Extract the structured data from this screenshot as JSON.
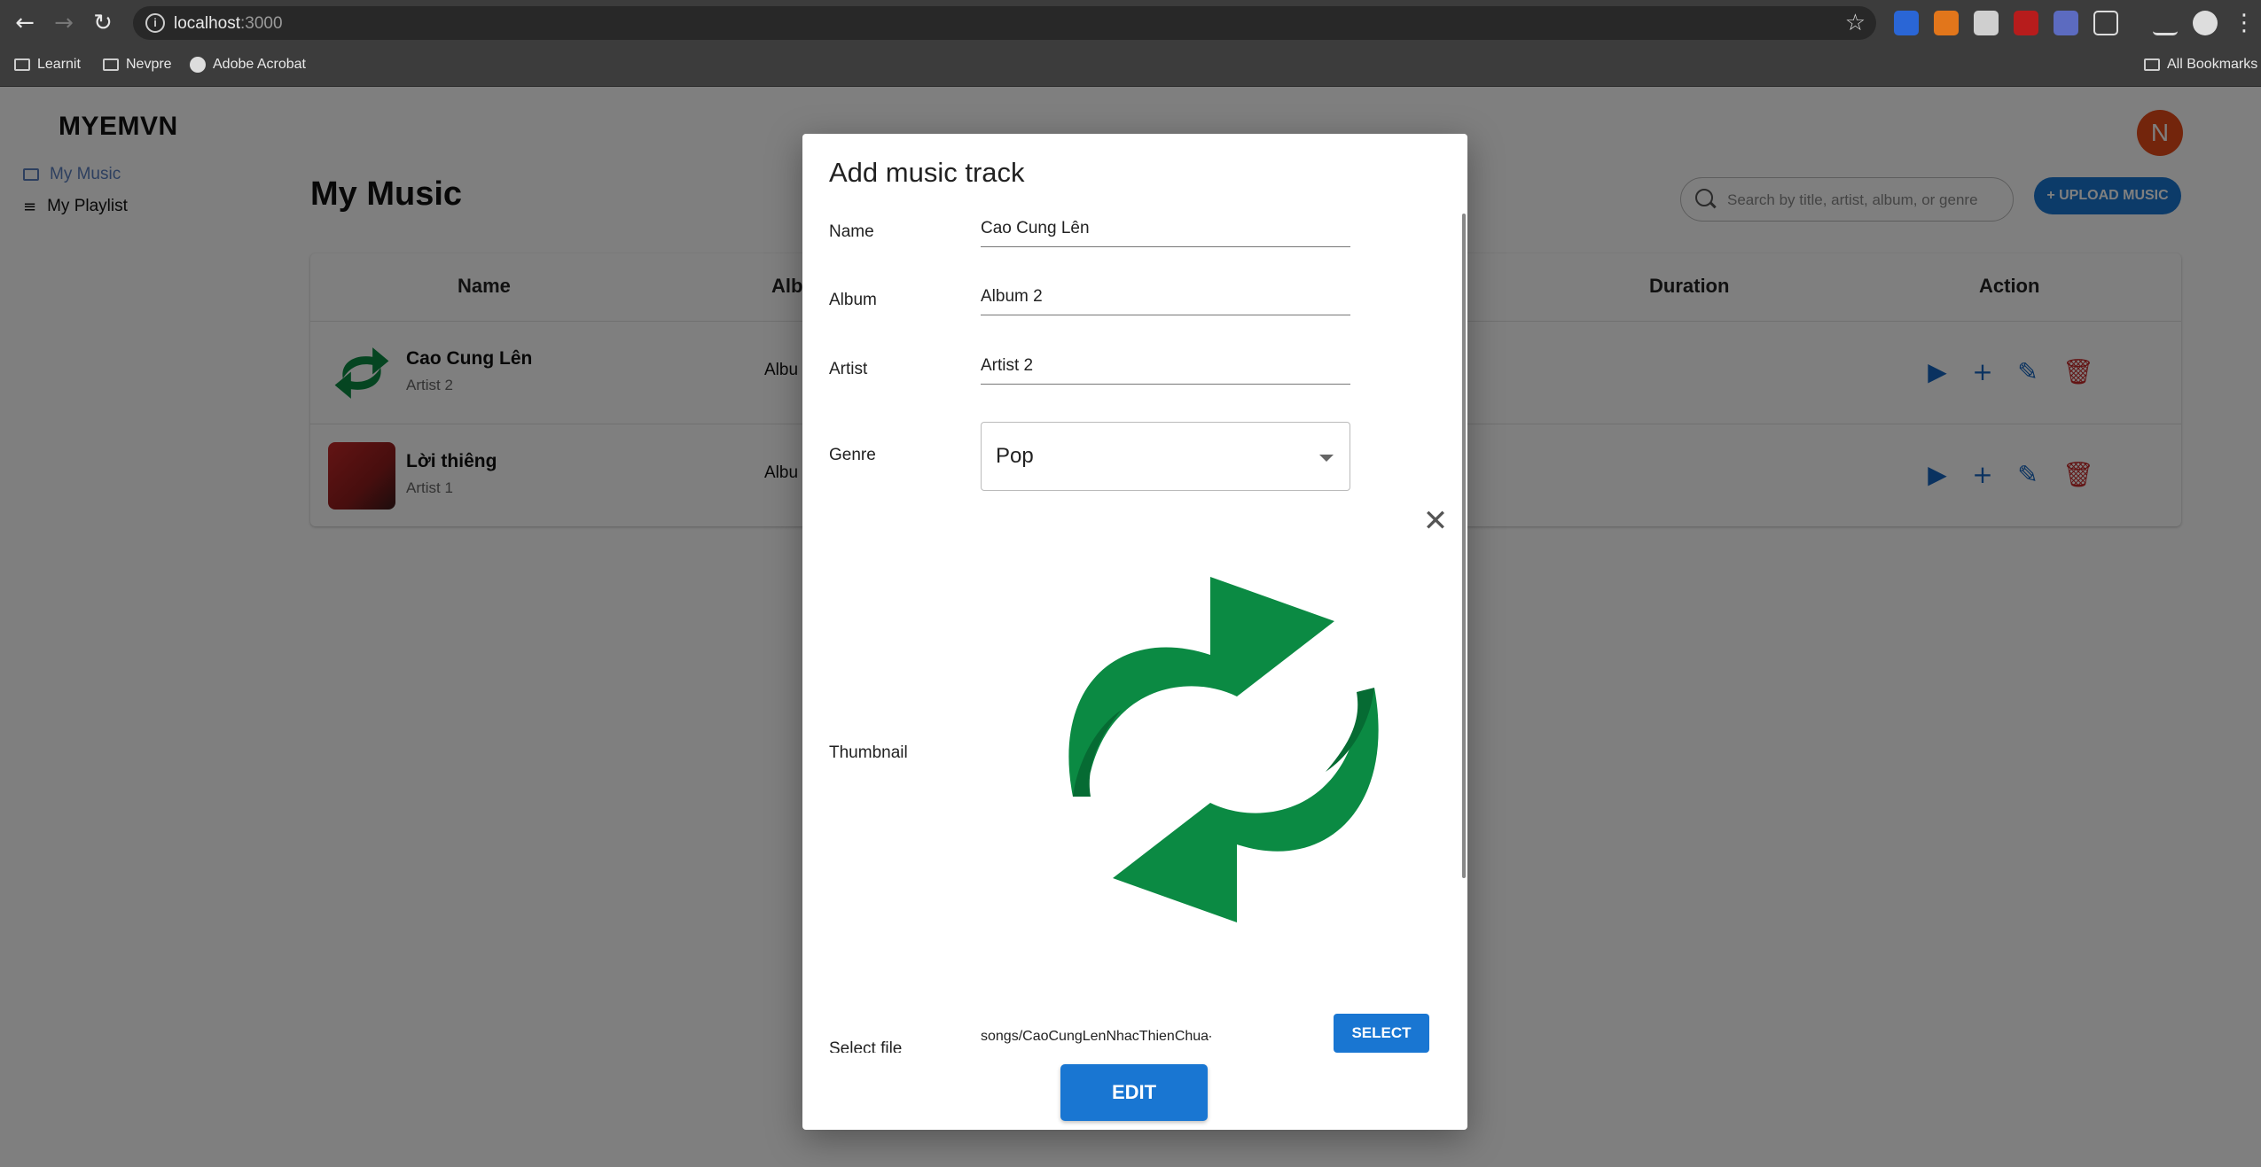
{
  "browser": {
    "url_host": "localhost",
    "url_port": ":3000",
    "bookmarks": [
      "Learnit",
      "Nevpre",
      "Adobe Acrobat"
    ],
    "all_bookmarks": "All Bookmarks"
  },
  "app": {
    "brand": "MYEMVN",
    "avatar_letter": "N",
    "sidebar": {
      "items": [
        {
          "label": "My Music"
        },
        {
          "label": "My Playlist"
        }
      ]
    },
    "page_title": "My Music",
    "search_placeholder": "Search by title, artist, album, or genre",
    "upload_label": "+ UPLOAD MUSIC",
    "table": {
      "headers": {
        "name": "Name",
        "album": "Albu",
        "duration": "Duration",
        "action": "Action"
      },
      "rows": [
        {
          "title": "Cao Cung Lên",
          "artist": "Artist 2",
          "album": "Albu"
        },
        {
          "title": "Lời thiêng",
          "artist": "Artist 1",
          "album": "Albu"
        }
      ]
    }
  },
  "modal": {
    "title": "Add music track",
    "labels": {
      "name": "Name",
      "album": "Album",
      "artist": "Artist",
      "genre": "Genre",
      "thumbnail": "Thumbnail",
      "file": "Select file"
    },
    "values": {
      "name": "Cao Cung Lên",
      "album": "Album 2",
      "artist": "Artist 2",
      "genre": "Pop",
      "file": "songs/CaoCungLenNhacThienChua-"
    },
    "select_label": "SELECT",
    "edit_label": "EDIT"
  },
  "colors": {
    "primary": "#1976d2",
    "danger": "#c62828",
    "avatar": "#e64a19",
    "refresh_green": "#0b8a43"
  }
}
